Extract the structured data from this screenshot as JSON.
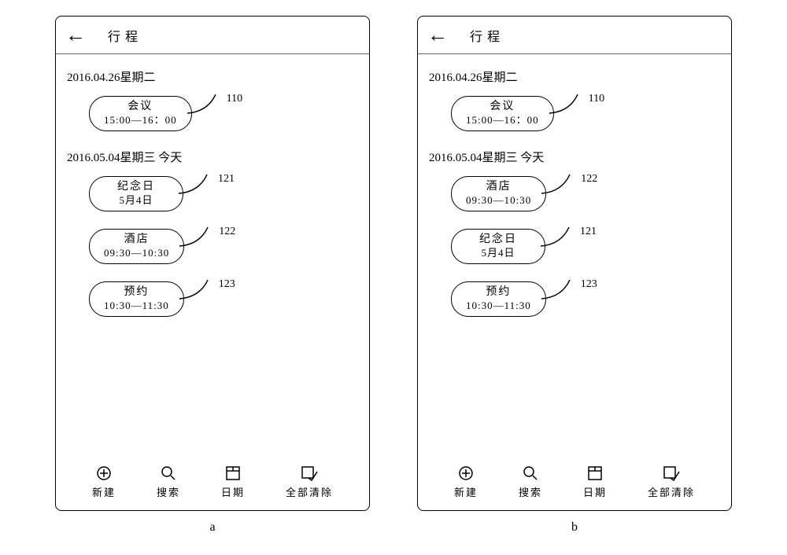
{
  "left": {
    "title": "行程",
    "date1": "2016.04.26星期二",
    "b110_l1": "会议",
    "b110_l2": "15:00—16：00",
    "b110_ref": "110",
    "date2": "2016.05.04星期三  今天",
    "b121_l1": "纪念日",
    "b121_l2": "5月4日",
    "b121_ref": "121",
    "b122_l1": "酒店",
    "b122_l2": "09:30—10:30",
    "b122_ref": "122",
    "b123_l1": "预约",
    "b123_l2": "10:30—11:30",
    "b123_ref": "123",
    "tab_new": "新建",
    "tab_search": "搜索",
    "tab_date": "日期",
    "tab_clear": "全部清除",
    "sub": "a"
  },
  "right": {
    "title": "行程",
    "date1": "2016.04.26星期二",
    "b110_l1": "会议",
    "b110_l2": "15:00—16：00",
    "b110_ref": "110",
    "date2": "2016.05.04星期三  今天",
    "b122_l1": "酒店",
    "b122_l2": "09:30—10:30",
    "b122_ref": "122",
    "b121_l1": "纪念日",
    "b121_l2": "5月4日",
    "b121_ref": "121",
    "b123_l1": "预约",
    "b123_l2": "10:30—11:30",
    "b123_ref": "123",
    "tab_new": "新建",
    "tab_search": "搜索",
    "tab_date": "日期",
    "tab_clear": "全部清除",
    "sub": "b"
  }
}
